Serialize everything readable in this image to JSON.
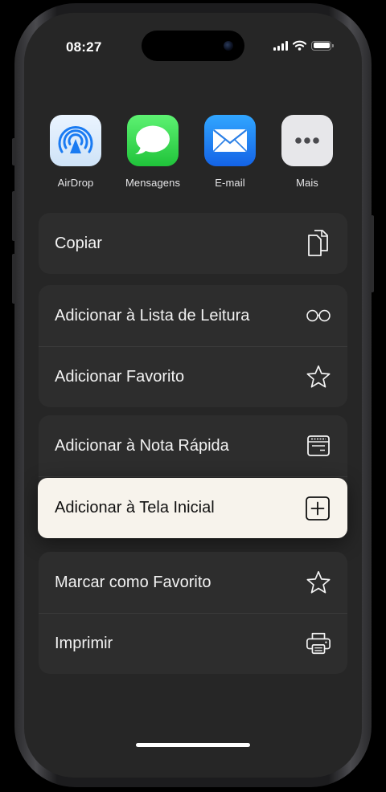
{
  "status_bar": {
    "time": "08:27"
  },
  "share_apps": [
    {
      "label": "AirDrop",
      "icon": "airdrop-icon"
    },
    {
      "label": "Mensagens",
      "icon": "messages-icon"
    },
    {
      "label": "E-mail",
      "icon": "mail-icon"
    },
    {
      "label": "Mais",
      "icon": "more-icon"
    }
  ],
  "actions": {
    "copy": {
      "label": "Copiar",
      "icon": "copy-icon"
    },
    "reading_list": {
      "label": "Adicionar à Lista de Leitura",
      "icon": "glasses-icon"
    },
    "add_bookmark": {
      "label": "Adicionar Favorito",
      "icon": "star-icon"
    },
    "quick_note": {
      "label": "Adicionar à Nota Rápida",
      "icon": "quick-note-icon"
    },
    "home_screen": {
      "label": "Adicionar à Tela Inicial",
      "icon": "plus-square-icon",
      "selected": true
    },
    "mark_favorite": {
      "label": "Marcar como Favorito",
      "icon": "star-icon"
    },
    "print": {
      "label": "Imprimir",
      "icon": "printer-icon"
    }
  },
  "colors": {
    "sheet_background": "#262626",
    "row_background": "#2d2d2d",
    "highlight_background": "#f7f3ec",
    "text": "#f2f2f2"
  }
}
